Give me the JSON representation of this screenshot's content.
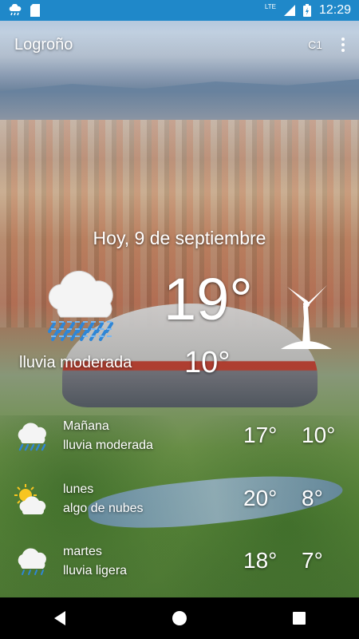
{
  "status_bar": {
    "time": "12:29",
    "network": "LTE",
    "icons": [
      "cloud-rain-notification-icon",
      "sd-card-icon",
      "signal-icon",
      "battery-charging-icon"
    ]
  },
  "app_bar": {
    "city": "Logroño",
    "unit_button": "C1",
    "menu_icon": "more-vert-icon"
  },
  "current": {
    "date": "Hoy, 9 de septiembre",
    "temp_max": "19°",
    "temp_min": "10°",
    "condition": "lluvia moderada",
    "icon": "rain-cloud-icon",
    "wind_icon": "wind-turbine-icon"
  },
  "forecast": [
    {
      "day": "Mañana",
      "desc": "lluvia moderada",
      "max": "17°",
      "min": "10°",
      "icon": "rain-cloud-icon"
    },
    {
      "day": "lunes",
      "desc": "algo de nubes",
      "max": "20°",
      "min": "8°",
      "icon": "sun-cloud-icon"
    },
    {
      "day": "martes",
      "desc": "lluvia ligera",
      "max": "18°",
      "min": "7°",
      "icon": "light-rain-cloud-icon"
    }
  ],
  "colors": {
    "status_bar": "#1f88c9",
    "nav_bar": "#000000",
    "rain_blue": "#2f86d6"
  },
  "navigation": [
    "back-icon",
    "home-icon",
    "recents-icon"
  ]
}
